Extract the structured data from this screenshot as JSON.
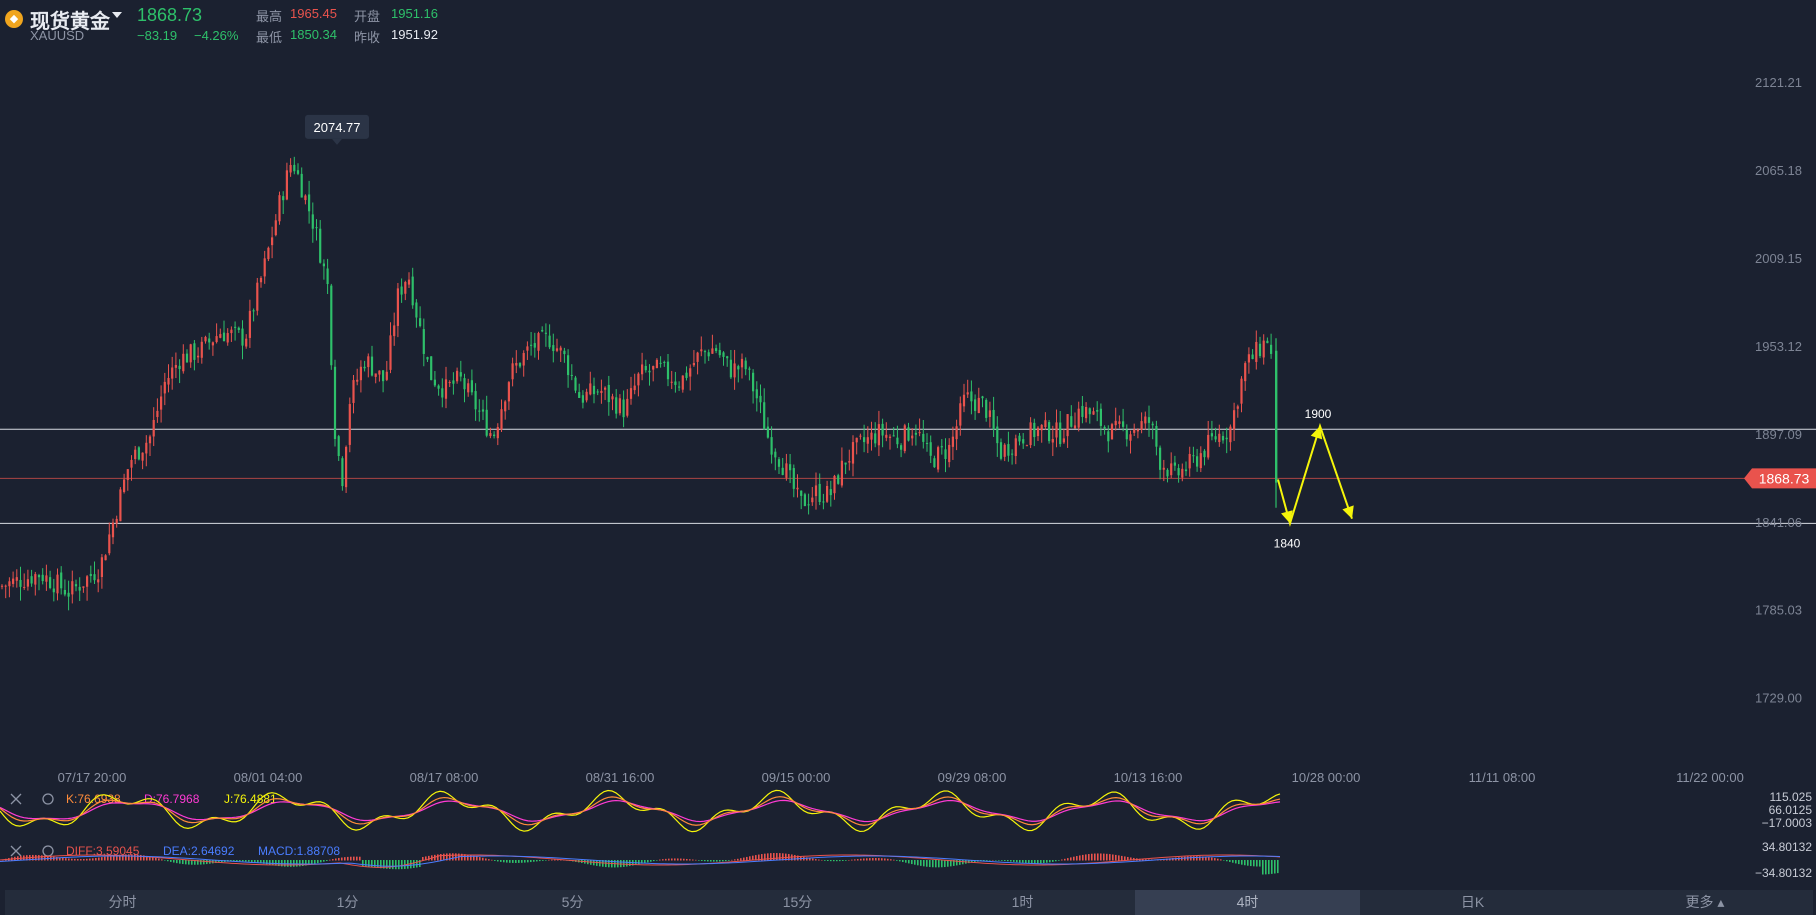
{
  "header": {
    "symbol_name": "现货黄金",
    "symbol_code": "XAUUSD",
    "last_price": "1868.73",
    "change": "−83.19",
    "change_pct": "−4.26%",
    "high_label": "最高",
    "high_value": "1965.45",
    "open_label": "开盘",
    "open_value": "1951.16",
    "low_label": "最低",
    "low_value": "1850.34",
    "prev_close_label": "昨收",
    "prev_close_value": "1951.92"
  },
  "colors": {
    "background": "#1b2130",
    "up": "#e9534d",
    "down": "#2ec06a",
    "annotation": "#f5f50a",
    "k_line": "#ff8c3a",
    "d_line": "#ff3bd4",
    "j_line": "#f5f50a",
    "diff_line": "#e9534d",
    "dea_line": "#4a7dff"
  },
  "chart_data": [
    {
      "type": "candlestick",
      "title": "",
      "y_axis_ticks": [
        "2121.21",
        "2065.18",
        "2009.15",
        "1953.12",
        "1897.09",
        "1841.06",
        "1785.03",
        "1729.00"
      ],
      "ylim": [
        1700,
        2140
      ],
      "x_axis_ticks": [
        "07/17 20:00",
        "08/01 04:00",
        "08/17 08:00",
        "08/31 16:00",
        "09/15 00:00",
        "09/29 08:00",
        "10/13 16:00",
        "10/28 00:00",
        "11/11 08:00",
        "11/22 00:00"
      ],
      "price_path": [
        [
          0,
          1800
        ],
        [
          40,
          1808
        ],
        [
          70,
          1796
        ],
        [
          100,
          1812
        ],
        [
          115,
          1845
        ],
        [
          130,
          1880
        ],
        [
          150,
          1895
        ],
        [
          165,
          1930
        ],
        [
          180,
          1945
        ],
        [
          200,
          1950
        ],
        [
          220,
          1962
        ],
        [
          245,
          1958
        ],
        [
          265,
          2005
        ],
        [
          280,
          2045
        ],
        [
          292,
          2072
        ],
        [
          300,
          2058
        ],
        [
          315,
          2028
        ],
        [
          328,
          1990
        ],
        [
          335,
          1900
        ],
        [
          342,
          1867
        ],
        [
          350,
          1920
        ],
        [
          365,
          1945
        ],
        [
          385,
          1930
        ],
        [
          398,
          1985
        ],
        [
          408,
          2000
        ],
        [
          418,
          1970
        ],
        [
          430,
          1935
        ],
        [
          445,
          1925
        ],
        [
          460,
          1932
        ],
        [
          480,
          1910
        ],
        [
          493,
          1895
        ],
        [
          510,
          1935
        ],
        [
          530,
          1952
        ],
        [
          550,
          1958
        ],
        [
          565,
          1945
        ],
        [
          580,
          1920
        ],
        [
          600,
          1925
        ],
        [
          625,
          1912
        ],
        [
          640,
          1935
        ],
        [
          660,
          1938
        ],
        [
          680,
          1930
        ],
        [
          700,
          1948
        ],
        [
          715,
          1952
        ],
        [
          730,
          1938
        ],
        [
          745,
          1940
        ],
        [
          758,
          1918
        ],
        [
          768,
          1895
        ],
        [
          785,
          1875
        ],
        [
          800,
          1852
        ],
        [
          815,
          1860
        ],
        [
          830,
          1858
        ],
        [
          845,
          1880
        ],
        [
          860,
          1890
        ],
        [
          880,
          1898
        ],
        [
          900,
          1893
        ],
        [
          915,
          1902
        ],
        [
          930,
          1880
        ],
        [
          950,
          1888
        ],
        [
          965,
          1920
        ],
        [
          985,
          1915
        ],
        [
          1000,
          1885
        ],
        [
          1020,
          1895
        ],
        [
          1040,
          1900
        ],
        [
          1060,
          1897
        ],
        [
          1080,
          1913
        ],
        [
          1095,
          1908
        ],
        [
          1110,
          1898
        ],
        [
          1130,
          1900
        ],
        [
          1150,
          1905
        ],
        [
          1160,
          1880
        ],
        [
          1175,
          1870
        ],
        [
          1195,
          1880
        ],
        [
          1215,
          1895
        ],
        [
          1230,
          1900
        ],
        [
          1245,
          1940
        ],
        [
          1258,
          1950
        ],
        [
          1268,
          1958
        ],
        [
          1274,
          1935
        ],
        [
          1276,
          1855
        ],
        [
          1278,
          1868.73
        ]
      ],
      "peak_label": "2074.77",
      "support_level": 1840,
      "resistance_level": 1900,
      "current_price_label": "1868.73",
      "current_price_value": 1868.73,
      "annotations": {
        "low_target": "1840",
        "high_target": "1900",
        "arrow_path": [
          [
            1278,
            1868
          ],
          [
            1290,
            1840
          ],
          [
            1320,
            1902
          ],
          [
            1352,
            1843
          ]
        ]
      }
    },
    {
      "type": "line",
      "name": "KDJ",
      "legend": {
        "k": "K:76.6938",
        "d": "D:76.7968",
        "j": "J:76.4881"
      },
      "y_axis_ticks": [
        "115.025",
        "66.0125",
        "−17.0003"
      ],
      "oscillation": "periodic"
    },
    {
      "type": "bar",
      "name": "MACD",
      "legend": {
        "diff": "DIFF:3.59045",
        "dea": "DEA:2.64692",
        "macd": "MACD:1.88708"
      },
      "y_axis_ticks": [
        "34.80132",
        "−34.80132"
      ]
    }
  ],
  "tabs": [
    "分时",
    "1分",
    "5分",
    "15分",
    "1时",
    "4时",
    "日K",
    "更多"
  ],
  "active_tab": "4时"
}
